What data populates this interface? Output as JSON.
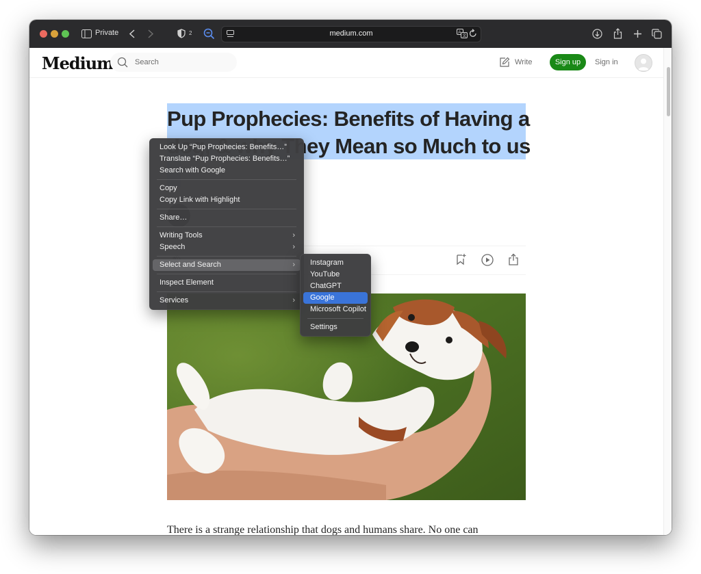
{
  "browser": {
    "private_label": "Private",
    "shield_count": "2",
    "url": "medium.com"
  },
  "header": {
    "logo": "Medium",
    "search_placeholder": "Search",
    "write_label": "Write",
    "signup_label": "Sign up",
    "signin_label": "Sign in"
  },
  "article": {
    "title": "Pup Prophecies: Benefits of Having a dog, & why They Mean so Much to us",
    "body_start": "There is a strange relationship that dogs and humans share. No one can"
  },
  "context_menu": {
    "items": [
      "Look Up “Pup Prophecies: Benefits…”",
      "Translate “Pup Prophecies: Benefits…”",
      "Search with Google",
      "Copy",
      "Copy Link with Highlight",
      "Share…",
      "Writing Tools",
      "Speech",
      "Select and Search",
      "Inspect Element",
      "Services"
    ]
  },
  "submenu": {
    "items": [
      "Instagram",
      "YouTube",
      "ChatGPT",
      "Google",
      "Microsoft Copilot",
      "Settings"
    ],
    "selected": "Google"
  },
  "colors": {
    "selection": "#b3d4fd",
    "signup_green": "#1a8917",
    "menu_highlight": "#3a74d9"
  }
}
